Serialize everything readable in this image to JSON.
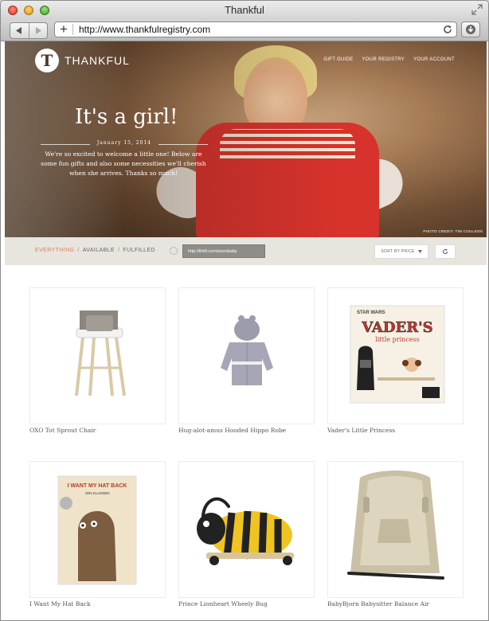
{
  "window": {
    "title": "Thankful"
  },
  "toolbar": {
    "url": "http://www.thankfulregistry.com"
  },
  "site": {
    "logo_letter": "T",
    "logo_text": "THANKFUL",
    "nav": [
      "GIFT GUIDE",
      "YOUR REGISTRY",
      "YOUR ACCOUNT"
    ]
  },
  "hero": {
    "heading": "It's a girl!",
    "date": "January 15, 2014",
    "message": "We're so excited to welcome a little one! Below are some fun gifts and also some necessities we'll cherish when she arrives. Thanks so much!",
    "photo_credit": "PHOTO CREDIT: TIM COULSON"
  },
  "filters": {
    "items": [
      "EVERYTHING",
      "AVAILABLE",
      "FULFILLED"
    ],
    "separator": "/",
    "share_url": "http://thkfl.com/anonbaby",
    "sort_label": "SORT BY PRICE"
  },
  "products": [
    {
      "name": "OXO Tot Sprout Chair"
    },
    {
      "name": "Hug-alot-amus Hooded Hippo Robe"
    },
    {
      "name": "Vader's Little Princess",
      "cover_brand": "STAR WARS",
      "cover_title_1": "VADER'S",
      "cover_title_2": "little princess"
    },
    {
      "name": "I Want My Hat Back",
      "cover_title": "I WANT MY HAT BACK",
      "cover_author": "JON KLASSEN"
    },
    {
      "name": "Prince Lionheart Wheely Bug"
    },
    {
      "name": "BabyBjorn Babysitter Balance Air"
    }
  ],
  "colors": {
    "accent": "#e07b56",
    "filterbar": "#e8e5df",
    "sweater": "#d8322c"
  }
}
